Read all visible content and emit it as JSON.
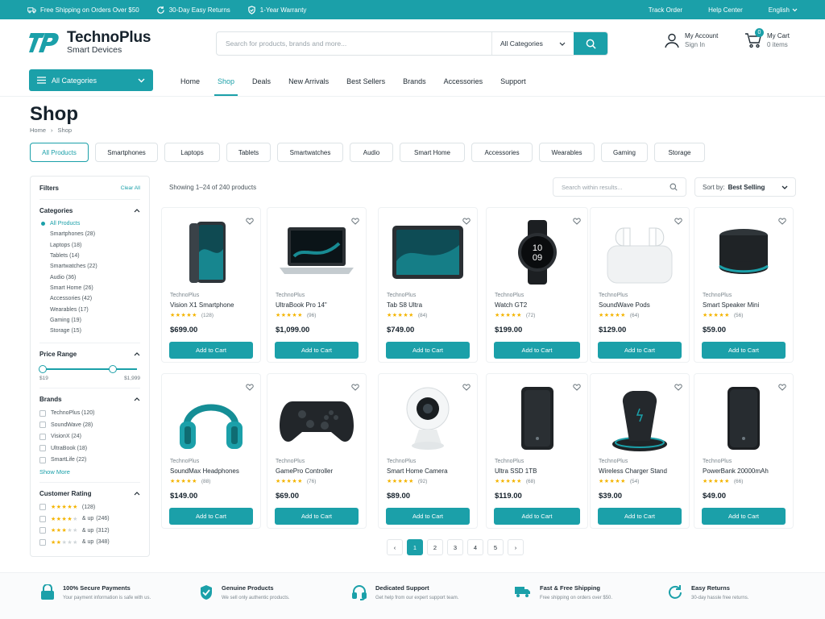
{
  "topbar": {
    "shipping": "Free Shipping on Orders Over $50",
    "returns": "30-Day Easy Returns",
    "warranty": "1-Year Warranty",
    "track": "Track Order",
    "help": "Help Center",
    "language": "English"
  },
  "brand": {
    "name": "TechnoPlus",
    "tagline": "Smart Devices"
  },
  "search": {
    "placeholder": "Search for products, brands and more...",
    "category": "All Categories"
  },
  "account": {
    "title": "My Account",
    "sub": "Sign In"
  },
  "cart": {
    "title": "My Cart",
    "sub": "0 items",
    "count": "0"
  },
  "nav": {
    "all_categories": "All Categories",
    "links": [
      "Home",
      "Shop",
      "Deals",
      "New Arrivals",
      "Best Sellers",
      "Brands",
      "Accessories",
      "Support"
    ],
    "active": "Shop"
  },
  "page": {
    "title": "Shop",
    "breadcrumb": [
      "Home",
      "Shop"
    ]
  },
  "chips": [
    "All Products",
    "Smartphones",
    "Laptops",
    "Tablets",
    "Smartwatches",
    "Audio",
    "Smart Home",
    "Accessories",
    "Wearables",
    "Gaming",
    "Storage"
  ],
  "filters": {
    "title": "Filters",
    "clear": "Clear All",
    "categories_title": "Categories",
    "categories": [
      "All Products",
      "Smartphones (28)",
      "Laptops (18)",
      "Tablets (14)",
      "Smartwatches (22)",
      "Audio (36)",
      "Smart Home (26)",
      "Accessories (42)",
      "Wearables (17)",
      "Gaming (19)",
      "Storage (15)"
    ],
    "price_title": "Price Range",
    "price_min": "$19",
    "price_max": "$1,999",
    "brands_title": "Brands",
    "brands": [
      "TechnoPlus (120)",
      "SoundWave (28)",
      "VisionX (24)",
      "UltraBook (18)",
      "SmartLife (22)"
    ],
    "show_more": "Show More",
    "rating_title": "Customer Rating",
    "ratings": [
      {
        "stars": 5,
        "label": "",
        "count": "(128)"
      },
      {
        "stars": 4,
        "label": "& up",
        "count": "(246)"
      },
      {
        "stars": 3,
        "label": "& up",
        "count": "(312)"
      },
      {
        "stars": 2,
        "label": "& up",
        "count": "(348)"
      }
    ]
  },
  "results": {
    "showing": "Showing 1–24 of 240 products",
    "within_placeholder": "Search within results...",
    "sort_label": "Sort by:",
    "sort_value": "Best Selling"
  },
  "products": [
    {
      "brand": "TechnoPlus",
      "name": "Vision X1 Smartphone",
      "reviews": "(128)",
      "price": "$699.00",
      "icon": "smartphone"
    },
    {
      "brand": "TechnoPlus",
      "name": "UltraBook Pro 14\"",
      "reviews": "(96)",
      "price": "$1,099.00",
      "icon": "laptop"
    },
    {
      "brand": "TechnoPlus",
      "name": "Tab S8 Ultra",
      "reviews": "(84)",
      "price": "$749.00",
      "icon": "tablet"
    },
    {
      "brand": "TechnoPlus",
      "name": "Watch GT2",
      "reviews": "(72)",
      "price": "$199.00",
      "icon": "smartwatch"
    },
    {
      "brand": "TechnoPlus",
      "name": "SoundWave Pods",
      "reviews": "(64)",
      "price": "$129.00",
      "icon": "earbuds"
    },
    {
      "brand": "TechnoPlus",
      "name": "Smart Speaker Mini",
      "reviews": "(56)",
      "price": "$59.00",
      "icon": "speaker"
    },
    {
      "brand": "TechnoPlus",
      "name": "SoundMax Headphones",
      "reviews": "(88)",
      "price": "$149.00",
      "icon": "headphones"
    },
    {
      "brand": "TechnoPlus",
      "name": "GamePro Controller",
      "reviews": "(76)",
      "price": "$69.00",
      "icon": "controller"
    },
    {
      "brand": "TechnoPlus",
      "name": "Smart Home Camera",
      "reviews": "(92)",
      "price": "$89.00",
      "icon": "camera"
    },
    {
      "brand": "TechnoPlus",
      "name": "Ultra SSD 1TB",
      "reviews": "(68)",
      "price": "$119.00",
      "icon": "ssd"
    },
    {
      "brand": "TechnoPlus",
      "name": "Wireless Charger Stand",
      "reviews": "(54)",
      "price": "$39.00",
      "icon": "charger"
    },
    {
      "brand": "TechnoPlus",
      "name": "PowerBank 20000mAh",
      "reviews": "(66)",
      "price": "$49.00",
      "icon": "powerbank"
    }
  ],
  "add_to_cart": "Add to Cart",
  "watch_time": "10 09",
  "pagination": {
    "pages": [
      "1",
      "2",
      "3",
      "4",
      "5"
    ],
    "active": "1"
  },
  "features": [
    {
      "title": "100% Secure Payments",
      "desc": "Your payment information is safe with us.",
      "icon": "lock"
    },
    {
      "title": "Genuine Products",
      "desc": "We sell only authentic products.",
      "icon": "shield-check"
    },
    {
      "title": "Dedicated Support",
      "desc": "Get help from our expert support team.",
      "icon": "headset"
    },
    {
      "title": "Fast & Free Shipping",
      "desc": "Free shipping on orders over $50.",
      "icon": "truck"
    },
    {
      "title": "Easy Returns",
      "desc": "30-day hassle free returns.",
      "icon": "return"
    }
  ],
  "colors": {
    "accent": "#1ba0a9",
    "star": "#f4b400",
    "dark": "#16222c"
  }
}
